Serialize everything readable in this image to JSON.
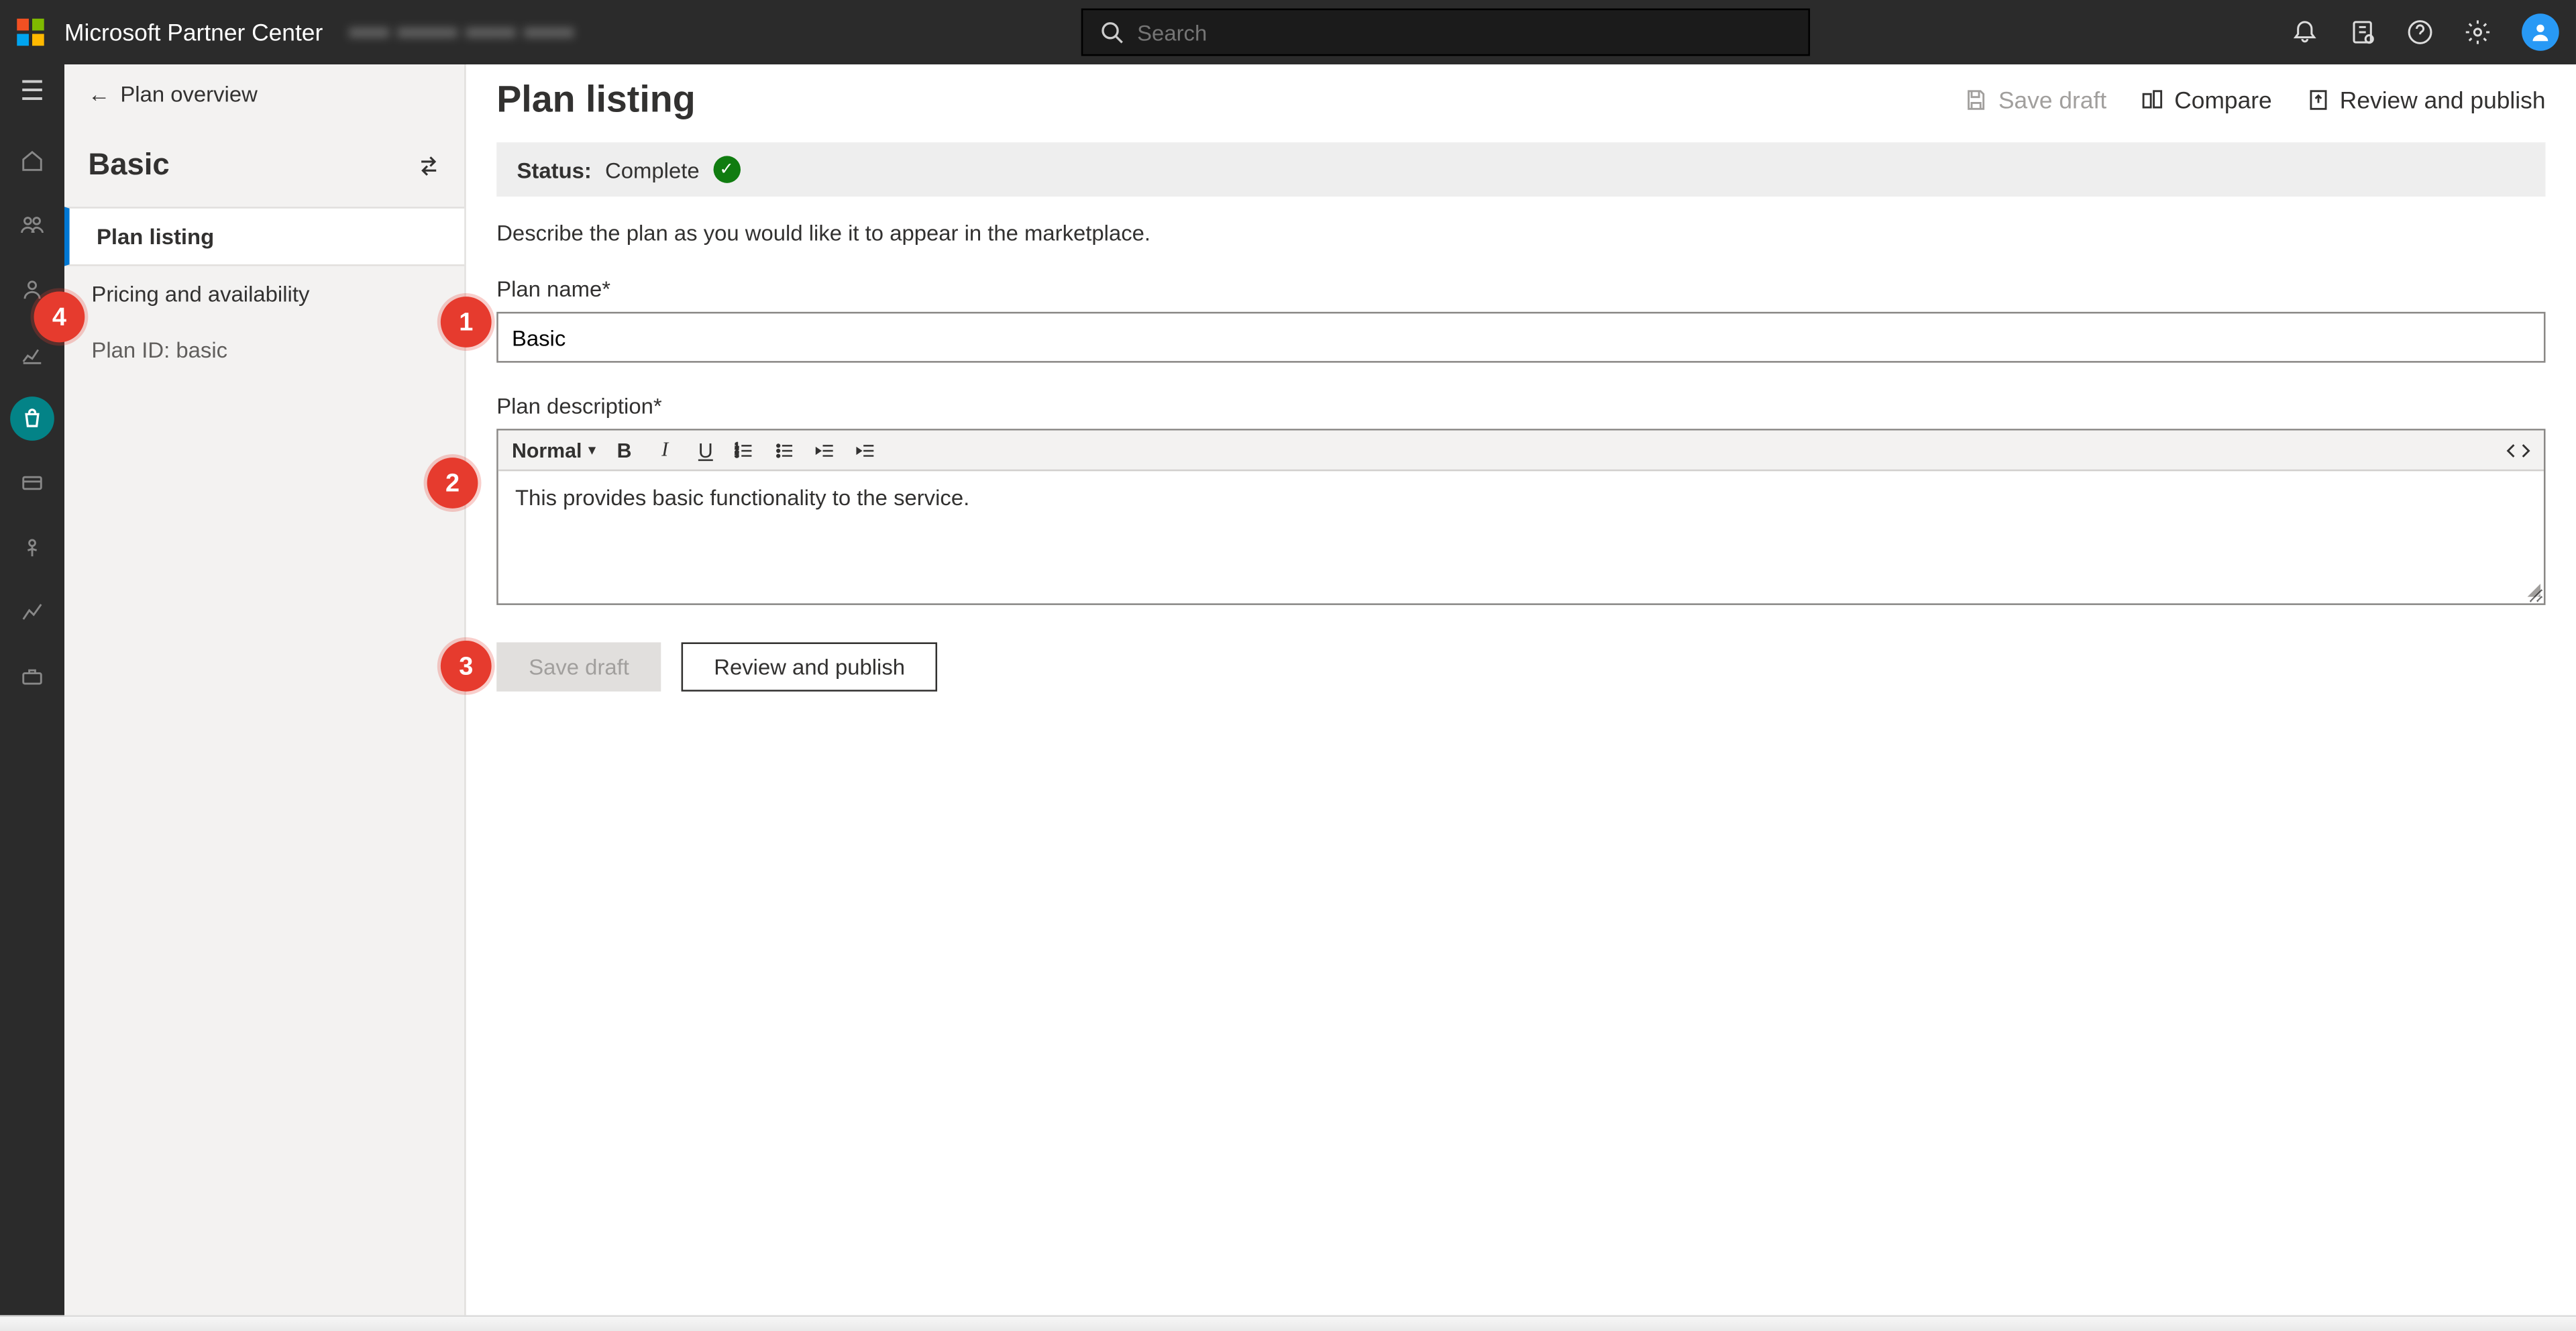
{
  "topbar": {
    "brand": "Microsoft Partner Center",
    "brand_suffix": "••••  •••••• •••••  •••••",
    "search_placeholder": "Search"
  },
  "rail": {
    "items": [
      "menu",
      "home",
      "people",
      "person",
      "chart",
      "marketplace",
      "grid",
      "ai",
      "analytics",
      "toolbox"
    ]
  },
  "side": {
    "back_label": "Plan overview",
    "title": "Basic",
    "nav": {
      "listing": "Plan listing",
      "pricing": "Pricing and availability"
    },
    "plan_id_label": "Plan ID: basic"
  },
  "page": {
    "title": "Plan listing",
    "actions": {
      "save_draft": "Save draft",
      "compare": "Compare",
      "review_publish": "Review and publish"
    },
    "status": {
      "label": "Status:",
      "value": "Complete"
    },
    "describe": "Describe the plan as you would like it to appear in the marketplace.",
    "plan_name_label": "Plan name*",
    "plan_name_value": "Basic",
    "plan_desc_label": "Plan description*",
    "rte": {
      "style": "Normal",
      "content": "This provides basic functionality to the service."
    },
    "buttons": {
      "save_draft": "Save draft",
      "review_publish": "Review and publish"
    }
  },
  "callouts": {
    "1": "1",
    "2": "2",
    "3": "3",
    "4": "4"
  }
}
